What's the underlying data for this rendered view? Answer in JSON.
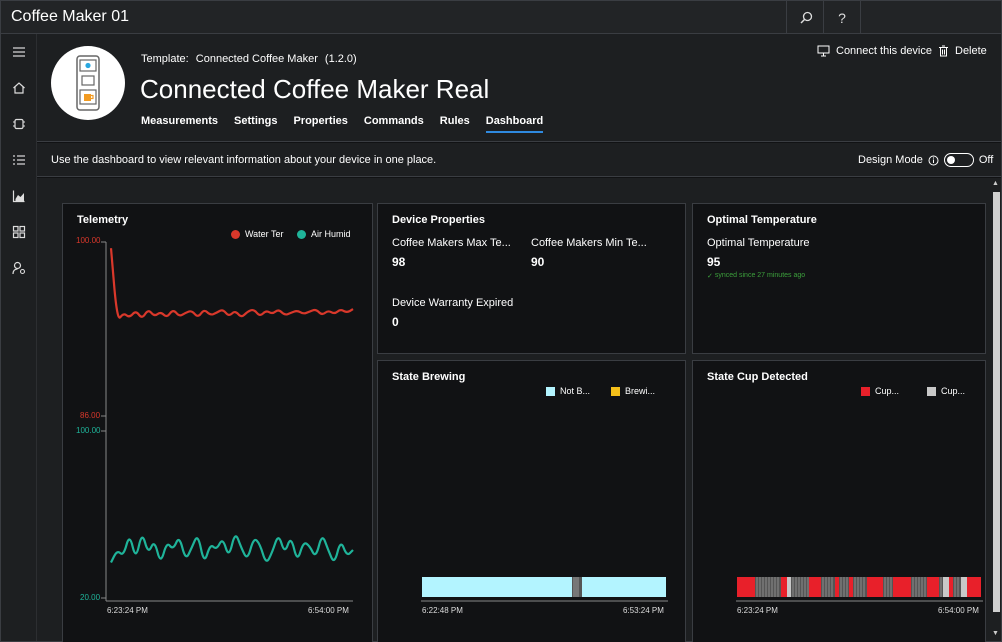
{
  "app": {
    "title": "Coffee Maker 01",
    "search_icon": "search-icon",
    "help_label": "?"
  },
  "nav": {
    "items": [
      {
        "icon": "hamburger-icon"
      },
      {
        "icon": "home-icon"
      },
      {
        "icon": "device-icon"
      },
      {
        "icon": "list-icon"
      },
      {
        "icon": "analytics-icon"
      },
      {
        "icon": "grid-icon"
      },
      {
        "icon": "admin-icon"
      }
    ]
  },
  "header": {
    "template_prefix": "Template:",
    "template_name": "Connected Coffee Maker",
    "template_version": "(1.2.0)",
    "device_title": "Connected Coffee Maker Real",
    "tabs": [
      "Measurements",
      "Settings",
      "Properties",
      "Commands",
      "Rules",
      "Dashboard"
    ],
    "active_tab": "Dashboard",
    "connect_label": "Connect this device",
    "delete_label": "Delete"
  },
  "infobar": {
    "text": "Use the dashboard to view relevant information about your device in one place.",
    "design_mode_label": "Design Mode",
    "design_mode_state": "Off"
  },
  "colors": {
    "water_temp": "#d9382b",
    "air_humidity": "#1fb49a",
    "not_brewing": "#b3f4ff",
    "brewing": "#f5c01a",
    "cup_red": "#e8202a",
    "cup_grey": "#c8c8c8",
    "accent": "#2f8ae0",
    "synced": "#3ca03c"
  },
  "telemetry": {
    "title": "Telemetry",
    "legend": [
      "Water Ter",
      "Air Humid"
    ],
    "y_top_max": "100.00",
    "y_top_min": "86.00",
    "y_bottom_max": "100.00",
    "y_bottom_min": "20.00",
    "x_start": "6:23:24 PM",
    "x_end": "6:54:00 PM"
  },
  "device_properties": {
    "title": "Device Properties",
    "items": [
      {
        "label": "Coffee Makers Max Te...",
        "value": "98"
      },
      {
        "label": "Coffee Makers Min Te...",
        "value": "90"
      },
      {
        "label": "Device Warranty Expired",
        "value": "0"
      }
    ]
  },
  "optimal_temperature": {
    "title": "Optimal Temperature",
    "label": "Optimal Temperature",
    "value": "95",
    "synced_text": "synced since 27 minutes ago"
  },
  "state_brewing": {
    "title": "State Brewing",
    "legend": [
      "Not B...",
      "Brewi..."
    ],
    "x_start": "6:22:48 PM",
    "x_end": "6:53:24 PM"
  },
  "state_cup": {
    "title": "State Cup Detected",
    "legend": [
      "Cup...",
      "Cup..."
    ],
    "x_start": "6:23:24 PM",
    "x_end": "6:54:00 PM"
  },
  "chart_data": [
    {
      "type": "line",
      "title": "Telemetry",
      "xlabel": "",
      "ylabel": "",
      "x": [
        "6:23:24 PM",
        "6:54:00 PM"
      ],
      "series": [
        {
          "name": "Water Ter",
          "ylim": [
            86,
            100
          ],
          "values": [
            99.5,
            93.6,
            94.3,
            93.9,
            94.5,
            93.8,
            94.6,
            94.0,
            94.4,
            93.9,
            94.6,
            94.0,
            94.3,
            94.5,
            93.9,
            94.6,
            94.1,
            94.3,
            94.6,
            94.0,
            94.5,
            93.9,
            94.4,
            94.6,
            94.0,
            94.5,
            94.2,
            94.6,
            94.1,
            94.3,
            94.5,
            94.2,
            94.4,
            94.6,
            94.1,
            94.5,
            94.2,
            94.6,
            94.3,
            94.6
          ]
        },
        {
          "name": "Air Humid",
          "ylim": [
            20,
            100
          ],
          "values": [
            37,
            43,
            40,
            51,
            38,
            52,
            41,
            48,
            36,
            47,
            43,
            50,
            38,
            44,
            51,
            36,
            46,
            43,
            49,
            39,
            52,
            44,
            38,
            49,
            46,
            36,
            42,
            51,
            41,
            50,
            37,
            47,
            45,
            39,
            51,
            43,
            36,
            48,
            40,
            43
          ]
        }
      ]
    }
  ]
}
